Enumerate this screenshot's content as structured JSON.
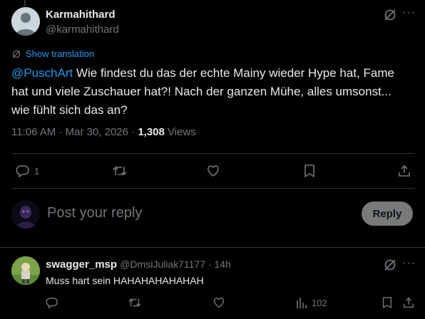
{
  "main_post": {
    "author_name": "Karmahithard",
    "author_handle": "@karmahithard",
    "show_translation": "Show translation",
    "mention": "@PuschArt",
    "text": " Wie findest du das der echte Mainy wieder Hype hat, Fame hat und viele Zuschauer hat?! Nach der ganzen Mühe, alles umsonst... wie fühlt sich das an?",
    "time": "11:06 AM · Mar 30, 2026 · ",
    "views_count": "1,308",
    "views_label": " Views",
    "reply_count": "1"
  },
  "composer": {
    "placeholder": "Post your reply",
    "reply_button": "Reply"
  },
  "reply_post": {
    "author_name": "swagger_msp",
    "author_handle": "@DmsiJuliak71177",
    "separator": " · ",
    "time": "14h",
    "text": "Muss hart sein HAHAHAHAHAHAH",
    "views": "102"
  },
  "colors": {
    "accent": "#1d9bf0",
    "background": "#000000",
    "muted": "#71767b",
    "divider": "#2f3336"
  },
  "icons": [
    "grok-icon",
    "more-icon",
    "translate-icon",
    "reply-icon",
    "repost-icon",
    "like-icon",
    "bookmark-icon",
    "share-icon",
    "views-icon"
  ]
}
